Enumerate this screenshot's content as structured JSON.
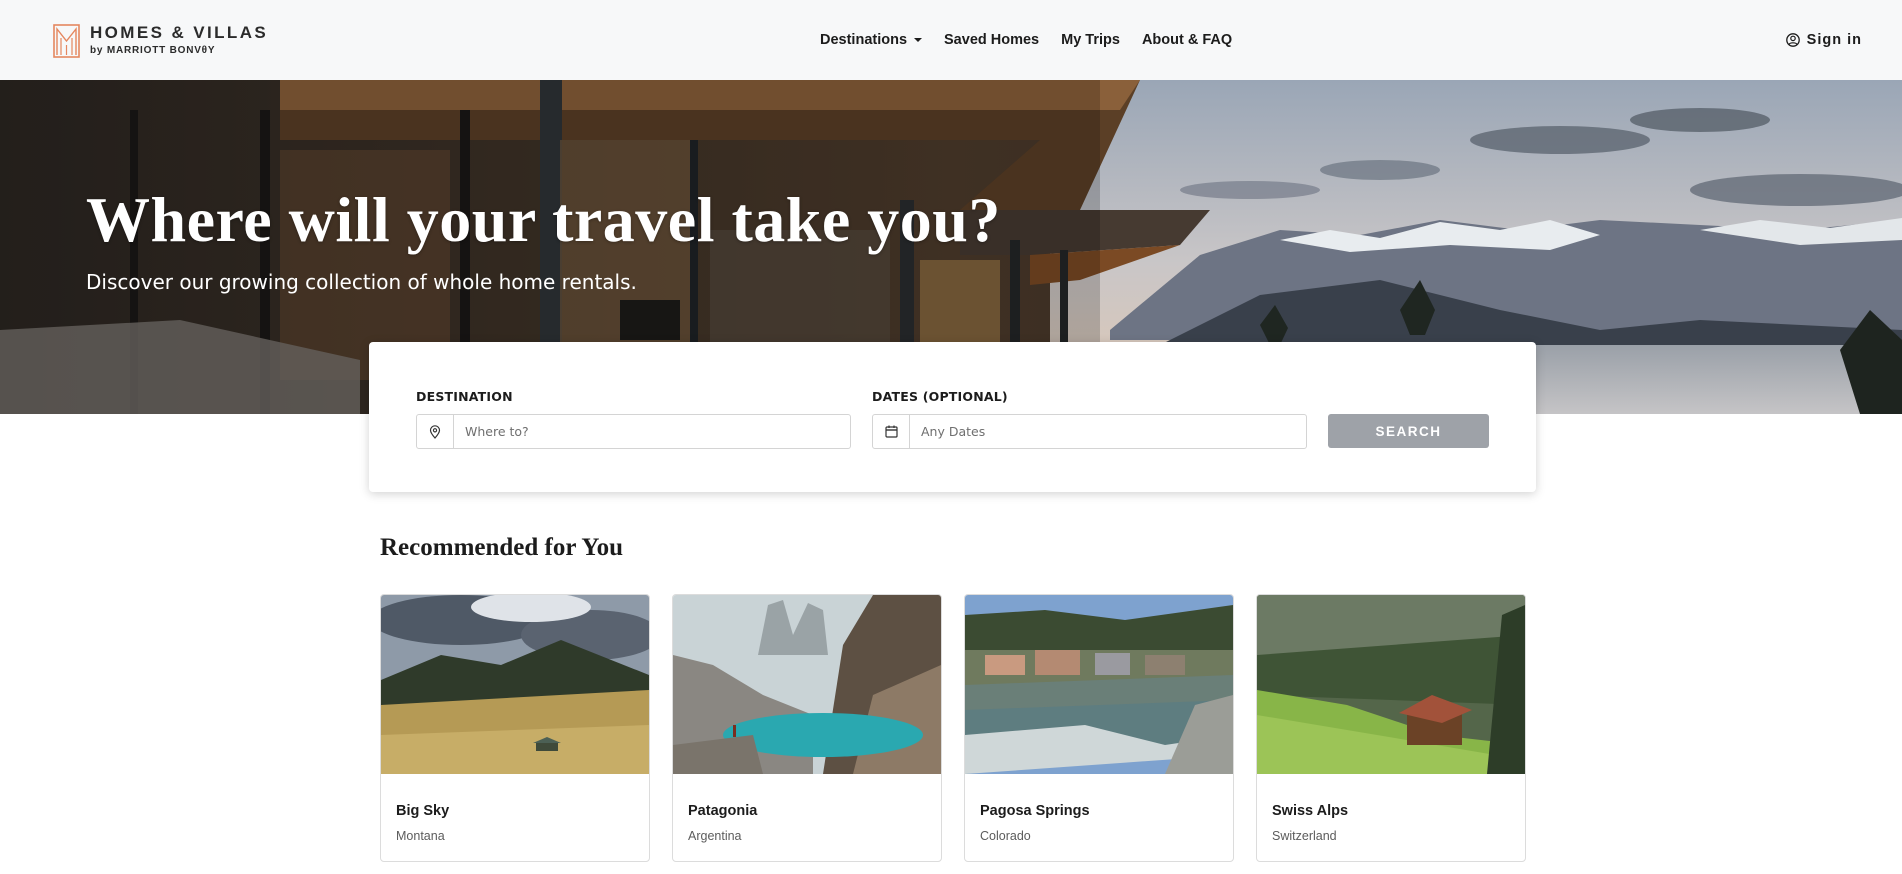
{
  "header": {
    "logo_line1": "HOMES & VILLAS",
    "logo_line2": "by MARRIOTT BONVθY",
    "nav": [
      "Destinations",
      "Saved Homes",
      "My Trips",
      "About & FAQ"
    ],
    "signin": "Sign in",
    "brand_color": "#e5875f"
  },
  "hero": {
    "title": "Where will your travel take you?",
    "subtitle": "Discover our growing collection of whole home rentals."
  },
  "search": {
    "destination_label": "DESTINATION",
    "destination_placeholder": "Where to?",
    "destination_icon": "map-pin-icon",
    "dates_label": "DATES (OPTIONAL)",
    "dates_placeholder": "Any Dates",
    "dates_icon": "calendar-icon",
    "button": "SEARCH",
    "button_color": "#9ea2a8"
  },
  "recommended": {
    "title": "Recommended for You",
    "cards": [
      {
        "name": "Big Sky",
        "region": "Montana"
      },
      {
        "name": "Patagonia",
        "region": "Argentina"
      },
      {
        "name": "Pagosa Springs",
        "region": "Colorado"
      },
      {
        "name": "Swiss Alps",
        "region": "Switzerland"
      }
    ]
  }
}
